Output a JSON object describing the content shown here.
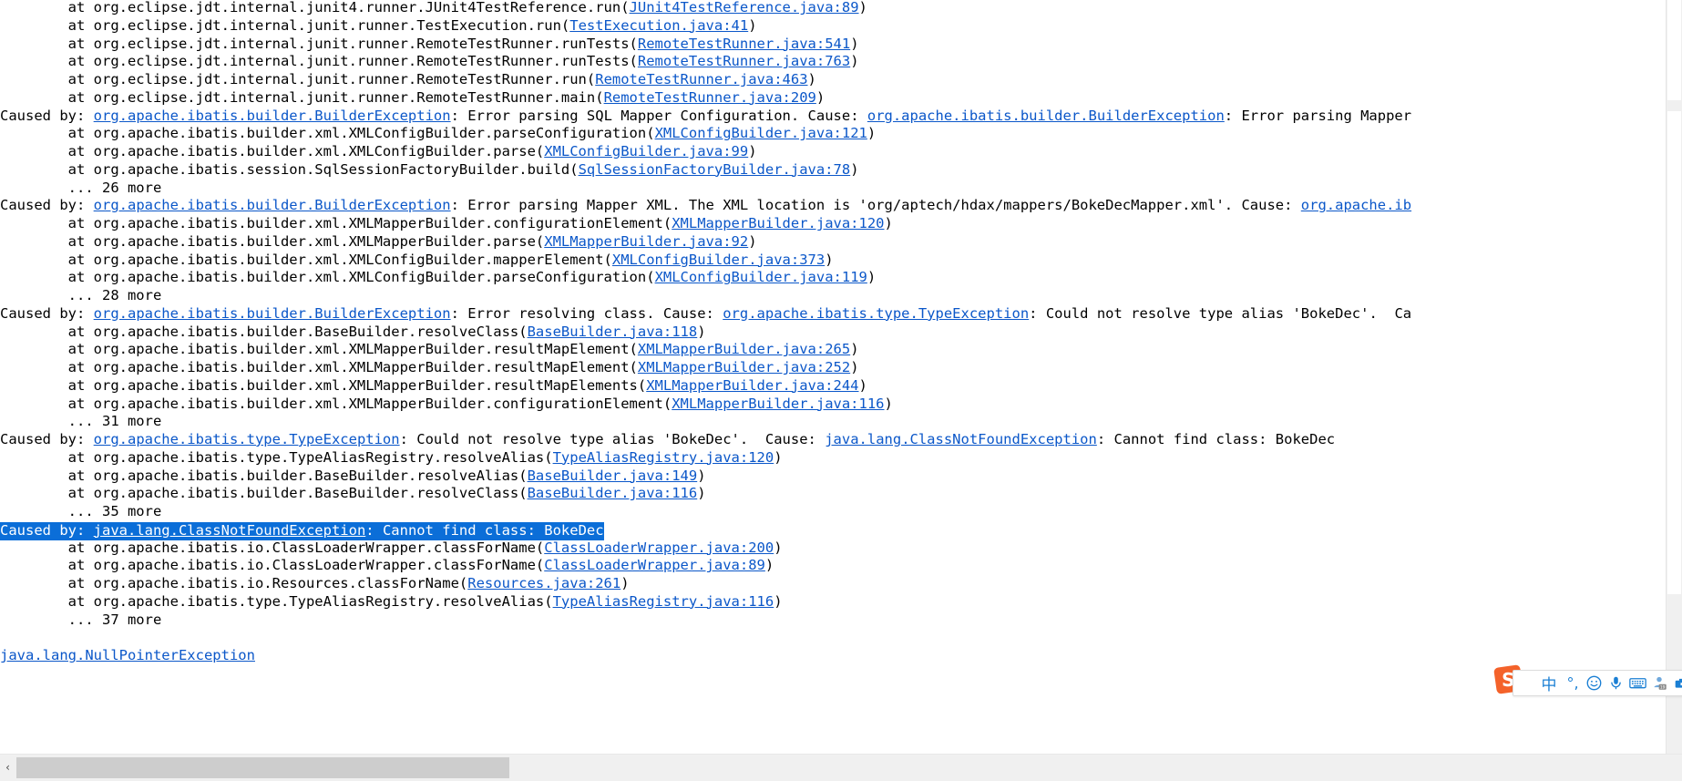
{
  "console": {
    "lines": [
      {
        "text": "\tat org.eclipse.jdt.internal.junit4.runner.JUnit4TestReference.run(",
        "link": "JUnit4TestReference.java:89",
        "tail": ")"
      },
      {
        "text": "\tat org.eclipse.jdt.internal.junit.runner.TestExecution.run(",
        "link": "TestExecution.java:41",
        "tail": ")"
      },
      {
        "text": "\tat org.eclipse.jdt.internal.junit.runner.RemoteTestRunner.runTests(",
        "link": "RemoteTestRunner.java:541",
        "tail": ")"
      },
      {
        "text": "\tat org.eclipse.jdt.internal.junit.runner.RemoteTestRunner.runTests(",
        "link": "RemoteTestRunner.java:763",
        "tail": ")"
      },
      {
        "text": "\tat org.eclipse.jdt.internal.junit.runner.RemoteTestRunner.run(",
        "link": "RemoteTestRunner.java:463",
        "tail": ")"
      },
      {
        "text": "\tat org.eclipse.jdt.internal.junit.runner.RemoteTestRunner.main(",
        "link": "RemoteTestRunner.java:209",
        "tail": ")"
      },
      {
        "text": "Caused by: ",
        "link": "org.apache.ibatis.builder.BuilderException",
        "tail": ": Error parsing SQL Mapper Configuration. Cause: ",
        "link2": "org.apache.ibatis.builder.BuilderException",
        "tail2": ": Error parsing Mapper"
      },
      {
        "text": "\tat org.apache.ibatis.builder.xml.XMLConfigBuilder.parseConfiguration(",
        "link": "XMLConfigBuilder.java:121",
        "tail": ")"
      },
      {
        "text": "\tat org.apache.ibatis.builder.xml.XMLConfigBuilder.parse(",
        "link": "XMLConfigBuilder.java:99",
        "tail": ")"
      },
      {
        "text": "\tat org.apache.ibatis.session.SqlSessionFactoryBuilder.build(",
        "link": "SqlSessionFactoryBuilder.java:78",
        "tail": ")"
      },
      {
        "text": "\t... 26 more",
        "link": "",
        "tail": ""
      },
      {
        "text": "Caused by: ",
        "link": "org.apache.ibatis.builder.BuilderException",
        "tail": ": Error parsing Mapper XML. The XML location is 'org/aptech/hdax/mappers/BokeDecMapper.xml'. Cause: ",
        "link2": "org.apache.ib",
        "tail2": ""
      },
      {
        "text": "\tat org.apache.ibatis.builder.xml.XMLMapperBuilder.configurationElement(",
        "link": "XMLMapperBuilder.java:120",
        "tail": ")"
      },
      {
        "text": "\tat org.apache.ibatis.builder.xml.XMLMapperBuilder.parse(",
        "link": "XMLMapperBuilder.java:92",
        "tail": ")"
      },
      {
        "text": "\tat org.apache.ibatis.builder.xml.XMLConfigBuilder.mapperElement(",
        "link": "XMLConfigBuilder.java:373",
        "tail": ")"
      },
      {
        "text": "\tat org.apache.ibatis.builder.xml.XMLConfigBuilder.parseConfiguration(",
        "link": "XMLConfigBuilder.java:119",
        "tail": ")"
      },
      {
        "text": "\t... 28 more",
        "link": "",
        "tail": ""
      },
      {
        "text": "Caused by: ",
        "link": "org.apache.ibatis.builder.BuilderException",
        "tail": ": Error resolving class. Cause: ",
        "link2": "org.apache.ibatis.type.TypeException",
        "tail2": ": Could not resolve type alias 'BokeDec'.  Ca"
      },
      {
        "text": "\tat org.apache.ibatis.builder.BaseBuilder.resolveClass(",
        "link": "BaseBuilder.java:118",
        "tail": ")"
      },
      {
        "text": "\tat org.apache.ibatis.builder.xml.XMLMapperBuilder.resultMapElement(",
        "link": "XMLMapperBuilder.java:265",
        "tail": ")"
      },
      {
        "text": "\tat org.apache.ibatis.builder.xml.XMLMapperBuilder.resultMapElement(",
        "link": "XMLMapperBuilder.java:252",
        "tail": ")"
      },
      {
        "text": "\tat org.apache.ibatis.builder.xml.XMLMapperBuilder.resultMapElements(",
        "link": "XMLMapperBuilder.java:244",
        "tail": ")"
      },
      {
        "text": "\tat org.apache.ibatis.builder.xml.XMLMapperBuilder.configurationElement(",
        "link": "XMLMapperBuilder.java:116",
        "tail": ")"
      },
      {
        "text": "\t... 31 more",
        "link": "",
        "tail": ""
      },
      {
        "text": "Caused by: ",
        "link": "org.apache.ibatis.type.TypeException",
        "tail": ": Could not resolve type alias 'BokeDec'.  Cause: ",
        "link2": "java.lang.ClassNotFoundException",
        "tail2": ": Cannot find class: BokeDec"
      },
      {
        "text": "\tat org.apache.ibatis.type.TypeAliasRegistry.resolveAlias(",
        "link": "TypeAliasRegistry.java:120",
        "tail": ")"
      },
      {
        "text": "\tat org.apache.ibatis.builder.BaseBuilder.resolveAlias(",
        "link": "BaseBuilder.java:149",
        "tail": ")"
      },
      {
        "text": "\tat org.apache.ibatis.builder.BaseBuilder.resolveClass(",
        "link": "BaseBuilder.java:116",
        "tail": ")"
      },
      {
        "text": "\t... 35 more",
        "link": "",
        "tail": ""
      },
      {
        "text": "Caused by: ",
        "link": "java.lang.ClassNotFoundException",
        "tail": ": Cannot find class: BokeDec",
        "selected": true
      },
      {
        "text": "\tat org.apache.ibatis.io.ClassLoaderWrapper.classForName(",
        "link": "ClassLoaderWrapper.java:200",
        "tail": ")"
      },
      {
        "text": "\tat org.apache.ibatis.io.ClassLoaderWrapper.classForName(",
        "link": "ClassLoaderWrapper.java:89",
        "tail": ")"
      },
      {
        "text": "\tat org.apache.ibatis.io.Resources.classForName(",
        "link": "Resources.java:261",
        "tail": ")"
      },
      {
        "text": "\tat org.apache.ibatis.type.TypeAliasRegistry.resolveAlias(",
        "link": "TypeAliasRegistry.java:116",
        "tail": ")"
      },
      {
        "text": "\t... 37 more",
        "link": "",
        "tail": ""
      },
      {
        "text": "",
        "link": "",
        "tail": ""
      },
      {
        "text": "",
        "link": "java.lang.NullPointerException",
        "tail": ""
      }
    ]
  },
  "scrollbars": {
    "horizontal": {
      "left_arrow": "‹",
      "right_arrow": "›"
    }
  },
  "ime": {
    "logo_text": "S",
    "mode_label": "中",
    "punctuation_label": "°,",
    "items": [
      {
        "name": "sogou-logo",
        "label": "S"
      },
      {
        "name": "ime-mode-chinese",
        "label": "中"
      },
      {
        "name": "ime-punctuation",
        "label": "°,"
      },
      {
        "name": "ime-emoji-icon",
        "label": ""
      },
      {
        "name": "ime-voice-input-icon",
        "label": ""
      },
      {
        "name": "ime-soft-keyboard-icon",
        "label": ""
      },
      {
        "name": "ime-user-icon",
        "label": ""
      },
      {
        "name": "ime-toolbox-icon",
        "label": ""
      }
    ]
  }
}
